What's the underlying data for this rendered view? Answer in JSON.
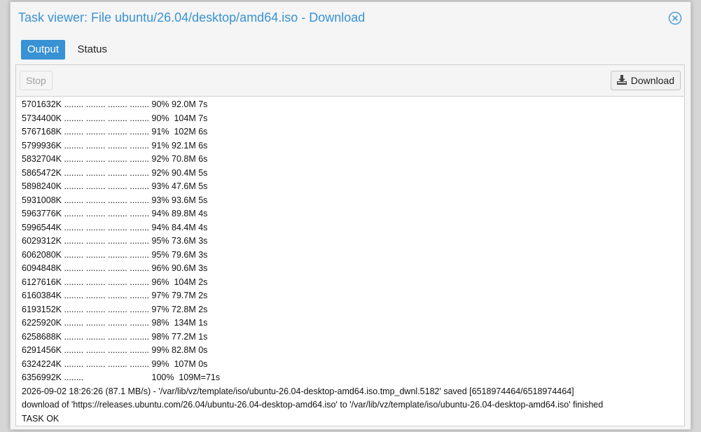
{
  "window": {
    "title": "Task viewer: File ubuntu/26.04/desktop/amd64.iso - Download",
    "close_icon": "circle-x-icon"
  },
  "tabs": [
    {
      "label": "Output",
      "active": true
    },
    {
      "label": "Status",
      "active": false
    }
  ],
  "toolbar": {
    "stop_label": "Stop",
    "stop_disabled": true,
    "download_label": "Download",
    "download_icon": "download-icon"
  },
  "log_lines": [
    "5701632K ........ ........ ........ ........ 90% 92.0M 7s",
    "5734400K ........ ........ ........ ........ 90%  104M 7s",
    "5767168K ........ ........ ........ ........ 91%  102M 6s",
    "5799936K ........ ........ ........ ........ 91% 92.1M 6s",
    "5832704K ........ ........ ........ ........ 92% 70.8M 6s",
    "5865472K ........ ........ ........ ........ 92% 90.4M 5s",
    "5898240K ........ ........ ........ ........ 93% 47.6M 5s",
    "5931008K ........ ........ ........ ........ 93% 93.6M 5s",
    "5963776K ........ ........ ........ ........ 94% 89.8M 4s",
    "5996544K ........ ........ ........ ........ 94% 84.4M 4s",
    "6029312K ........ ........ ........ ........ 95% 73.6M 3s",
    "6062080K ........ ........ ........ ........ 95% 79.6M 3s",
    "6094848K ........ ........ ........ ........ 96% 90.6M 3s",
    "6127616K ........ ........ ........ ........ 96%  104M 2s",
    "6160384K ........ ........ ........ ........ 97% 79.7M 2s",
    "6193152K ........ ........ ........ ........ 97% 72.8M 2s",
    "6225920K ........ ........ ........ ........ 98%  134M 1s",
    "6258688K ........ ........ ........ ........ 98% 77.2M 1s",
    "6291456K ........ ........ ........ ........ 99% 82.8M 0s",
    "6324224K ........ ........ ........ ........ 99%  107M 0s",
    "6356992K ........                            100%  109M=71s",
    "2026-09-02 18:26:26 (87.1 MB/s) - '/var/lib/vz/template/iso/ubuntu-26.04-desktop-amd64.iso.tmp_dwnl.5182' saved [6518974464/6518974464]",
    "download of 'https://releases.ubuntu.com/26.04/ubuntu-26.04-desktop-amd64.iso' to '/var/lib/vz/template/iso/ubuntu-26.04-desktop-amd64.iso' finished",
    "TASK OK"
  ],
  "colors": {
    "accent": "#3892d4",
    "panel_bg": "#ffffff",
    "window_bg": "#f5f5f5"
  }
}
